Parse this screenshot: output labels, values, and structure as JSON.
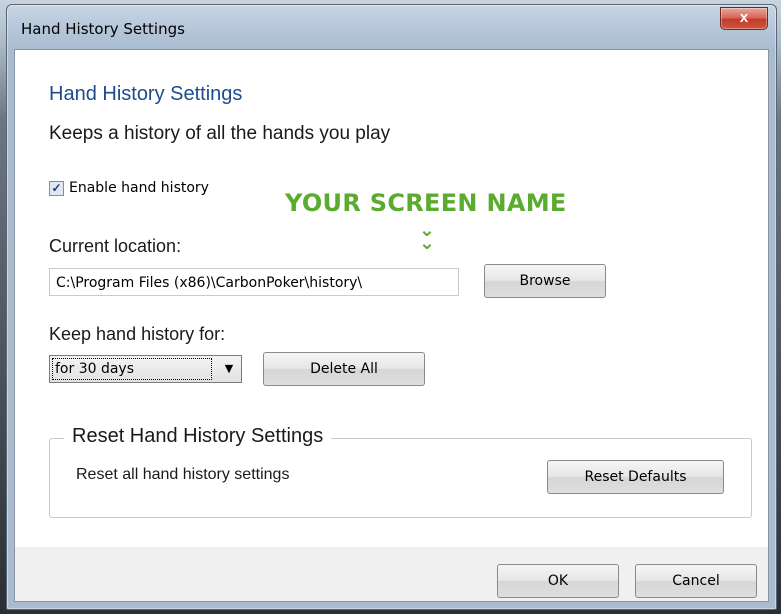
{
  "window": {
    "title": "Hand History Settings",
    "close_label": "x"
  },
  "content": {
    "heading": "Hand History Settings",
    "description": "Keeps a history of all the hands you play",
    "enable_checkbox": {
      "label": "Enable hand history",
      "checked": true,
      "check_glyph": "✓"
    },
    "annotation": "YOUR SCREEN NAME",
    "annotation_color": "#5aab2e",
    "location_label": "Current location:",
    "location_value": "C:\\Program Files (x86)\\CarbonPoker\\history\\",
    "browse_label": "Browse",
    "keep_label": "Keep hand history for:",
    "keep_selected": "for 30 days",
    "delete_all_label": "Delete All",
    "reset_group": {
      "legend": "Reset Hand History Settings",
      "description": "Reset all hand history settings",
      "reset_label": "Reset Defaults"
    }
  },
  "footer": {
    "ok_label": "OK",
    "cancel_label": "Cancel"
  },
  "colors": {
    "heading": "#1e4b8c",
    "annotation": "#5aab2e",
    "close_button": "#c23b2b"
  }
}
